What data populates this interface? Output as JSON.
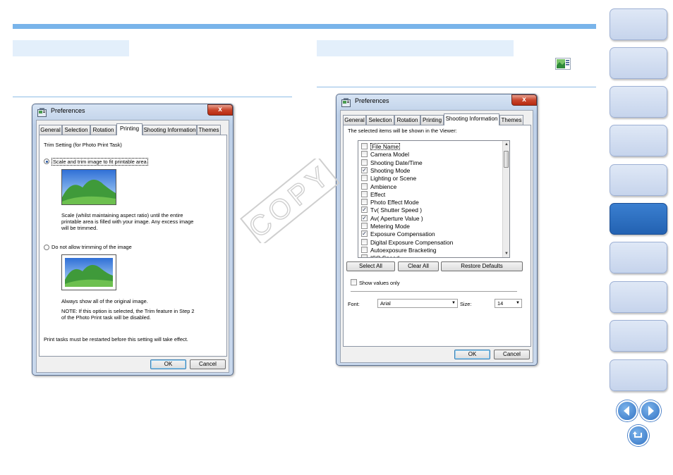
{
  "dialog_printing": {
    "title": "Preferences",
    "close_label": "x",
    "tabs": [
      "General",
      "Selection",
      "Rotation",
      "Printing",
      "Shooting Information",
      "Themes"
    ],
    "active_tab": "Printing",
    "group_label": "Trim Setting (for Photo Print Task)",
    "option_scale_label": "Scale and trim image to fit printable area",
    "option_scale_desc": [
      "Scale (whilst maintaining aspect ratio) until the entire",
      "printable area is filled with your image. Any excess image",
      "will be trimmed."
    ],
    "option_notrim_label": "Do not allow trimming of the image",
    "option_notrim_desc": "Always show all of the original image.",
    "note": [
      "NOTE: If this option is selected, the Trim feature in Step 2",
      "of the Photo Print task will be disabled."
    ],
    "restart_note": "Print tasks must be restarted before this setting will take effect.",
    "ok_label": "OK",
    "cancel_label": "Cancel"
  },
  "dialog_shooting": {
    "title": "Preferences",
    "close_label": "x",
    "tabs": [
      "General",
      "Selection",
      "Rotation",
      "Printing",
      "Shooting Information",
      "Themes"
    ],
    "active_tab": "Shooting Information",
    "hint": "The selected items will be shown in the Viewer:",
    "items": [
      {
        "label": "File Name",
        "checked": false
      },
      {
        "label": "Camera Model",
        "checked": false
      },
      {
        "label": "Shooting Date/Time",
        "checked": false
      },
      {
        "label": "Shooting Mode",
        "checked": true
      },
      {
        "label": "Lighting or Scene",
        "checked": false
      },
      {
        "label": "Ambience",
        "checked": false
      },
      {
        "label": "Effect",
        "checked": false
      },
      {
        "label": "Photo Effect Mode",
        "checked": false
      },
      {
        "label": "Tv( Shutter Speed )",
        "checked": true
      },
      {
        "label": "Av( Aperture Value )",
        "checked": true
      },
      {
        "label": "Metering Mode",
        "checked": false
      },
      {
        "label": "Exposure Compensation",
        "checked": true
      },
      {
        "label": "Digital Exposure Compensation",
        "checked": false
      },
      {
        "label": "Autoexposure Bracketing",
        "checked": false
      },
      {
        "label": "ISO Speed",
        "checked": false
      }
    ],
    "select_all_label": "Select All",
    "clear_all_label": "Clear All",
    "restore_defaults_label": "Restore Defaults",
    "show_values_only_label": "Show values only",
    "font_label": "Font:",
    "font_value": "Arial",
    "size_label": "Size:",
    "size_value": "14",
    "ok_label": "OK",
    "cancel_label": "Cancel"
  },
  "watermark_text": "COPY",
  "colors": {
    "accent_bar": "#79b4ea",
    "section_tab": "#e3effb",
    "nav_button": "#d3def1",
    "nav_button_active": "#2b6cbf"
  },
  "nav": {
    "button_count": 10,
    "active_index": 5,
    "icons": [
      "arrow-left-icon",
      "arrow-right-icon",
      "return-icon"
    ]
  }
}
